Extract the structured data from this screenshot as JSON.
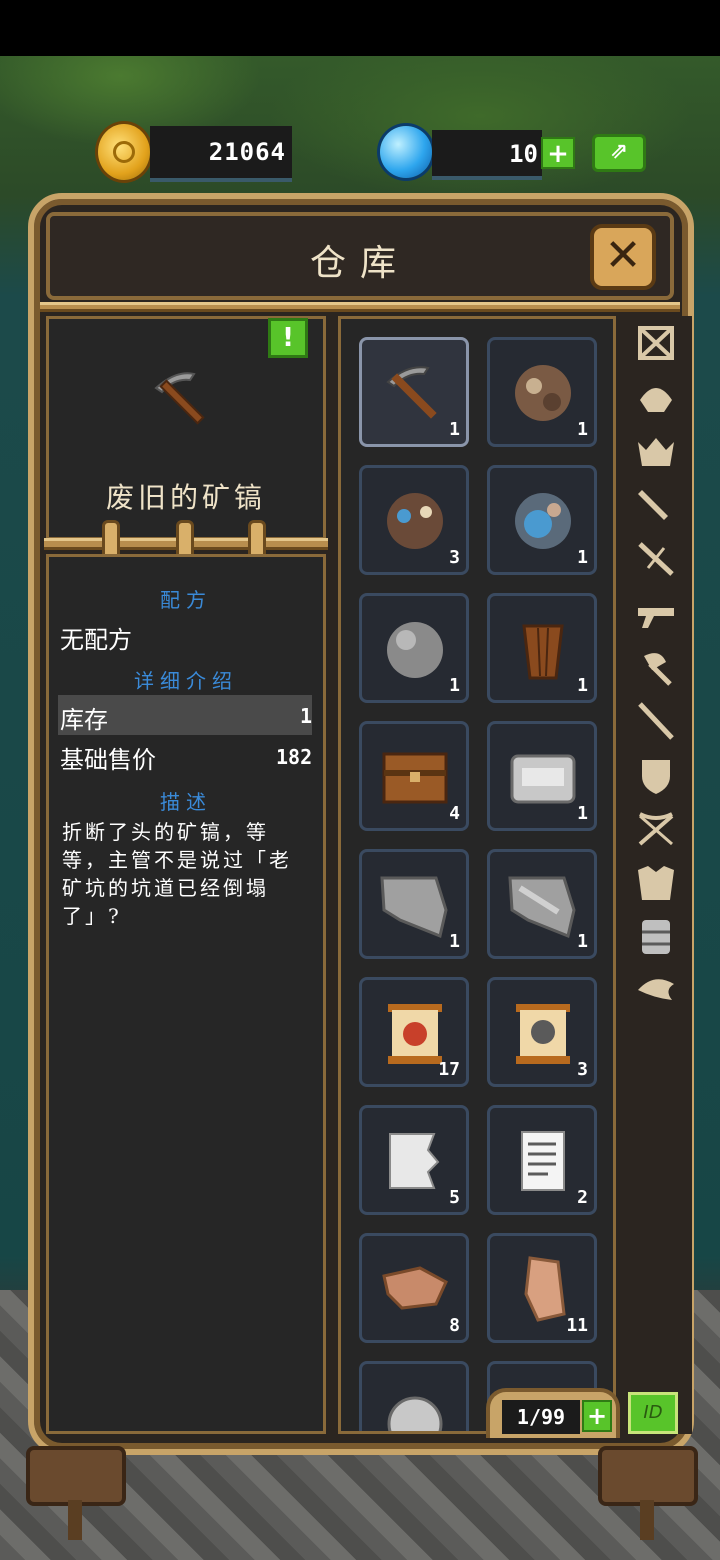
{
  "currency": {
    "coins": "21064",
    "gems": "10",
    "gem_plus": "+"
  },
  "window": {
    "title": "仓库",
    "close": "✕"
  },
  "selected_item": {
    "alert": "!",
    "name": "废旧的矿镐",
    "icon": "pickaxe-icon"
  },
  "details": {
    "recipe_heading": "配方",
    "recipe_value": "无配方",
    "info_heading": "详细介绍",
    "stock_label": "库存",
    "stock_value": "1",
    "price_label": "基础售价",
    "price_value": "182",
    "desc_heading": "描述",
    "description": "折断了头的矿镐，等等，主管不是说过「老矿坑的坑道已经倒塌了」?"
  },
  "inventory": [
    {
      "icon": "pickaxe-icon",
      "count": "1",
      "selected": true
    },
    {
      "icon": "ore-rock-icon",
      "count": "1"
    },
    {
      "icon": "blue-ore-rock-icon",
      "count": "3"
    },
    {
      "icon": "blue-crystal-rock-icon",
      "count": "1"
    },
    {
      "icon": "stone-ball-icon",
      "count": "1"
    },
    {
      "icon": "wooden-bucket-icon",
      "count": "1"
    },
    {
      "icon": "wooden-chest-icon",
      "count": "4"
    },
    {
      "icon": "iron-chest-icon",
      "count": "1"
    },
    {
      "icon": "grey-cloth-icon",
      "count": "1"
    },
    {
      "icon": "grey-cloth-pattern-icon",
      "count": "1"
    },
    {
      "icon": "scroll-red-icon",
      "count": "17"
    },
    {
      "icon": "scroll-ghost-icon",
      "count": "3"
    },
    {
      "icon": "paper-torn-icon",
      "count": "5"
    },
    {
      "icon": "paper-document-icon",
      "count": "2"
    },
    {
      "icon": "leather-scrap-icon",
      "count": "8"
    },
    {
      "icon": "leather-hide-icon",
      "count": "11"
    },
    {
      "icon": "silver-coin-icon",
      "count": ""
    },
    {
      "icon": "gold-item-icon",
      "count": ""
    }
  ],
  "categories": [
    "all-icon",
    "helmet-icon",
    "crown-icon",
    "dagger-icon",
    "swords-icon",
    "gun-icon",
    "axe-icon",
    "staff-icon",
    "shield-icon",
    "crossbow-icon",
    "chest-armor-icon",
    "barrel-icon",
    "wing-icon"
  ],
  "capacity": {
    "value": "1/99",
    "plus": "+",
    "id_label": "ID"
  },
  "colors": {
    "frame": "#c8a468",
    "panel": "#262626",
    "accent_green": "#58c42a",
    "heading_blue": "#3a8ad8"
  }
}
